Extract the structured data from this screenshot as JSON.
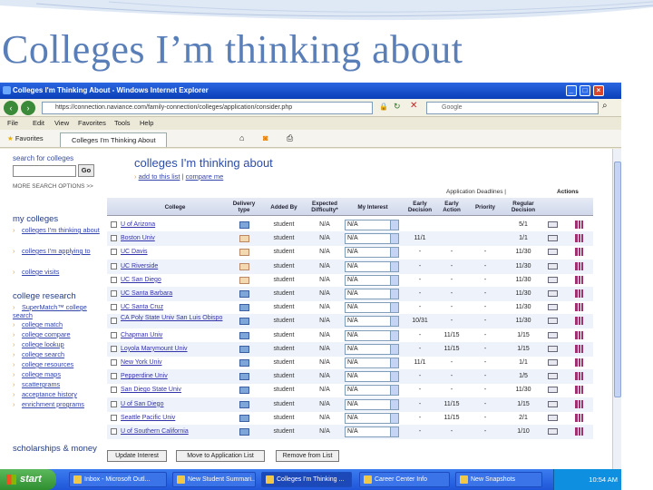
{
  "slide": {
    "title": "Colleges I’m thinking about"
  },
  "window": {
    "title": "Colleges I'm Thinking About - Windows Internet Explorer",
    "url": "https://connection.naviance.com/family-connection/colleges/application/consider.php",
    "search_placeholder": "Google",
    "menu": [
      "File",
      "Edit",
      "View",
      "Favorites",
      "Tools",
      "Help"
    ],
    "favorites_label": "Favorites",
    "tab_label": "Colleges I'm Thinking About"
  },
  "sidebar": {
    "search_label": "search for colleges",
    "go_label": "Go",
    "more_options": "MORE SEARCH OPTIONS >>",
    "my_colleges_heading": "my colleges",
    "my_colleges_links": [
      "colleges I'm thinking about",
      "colleges I'm applying to",
      "college visits"
    ],
    "research_heading": "college research",
    "research_links": [
      "SuperMatch™ college search",
      "college match",
      "college compare",
      "college lookup",
      "college search",
      "college resources",
      "college maps",
      "scattergrams",
      "acceptance history",
      "enrichment programs"
    ],
    "scholarships_heading": "scholarships & money"
  },
  "main": {
    "title": "colleges I'm thinking about",
    "add_link": "add to this list",
    "sep": "|",
    "compare_link": "compare me"
  },
  "table": {
    "deadlines_header": "Application Deadlines |",
    "actions_header": "Actions",
    "columns": {
      "college": "College",
      "delivery": "Delivery type",
      "added_by": "Added By",
      "difficulty": "Expected Difficulty*",
      "interest": "My Interest",
      "early_decision": "Early Decision",
      "early_action": "Early Action",
      "priority": "Priority",
      "regular": "Regular Decision"
    },
    "rows": [
      {
        "college": "U of Arizona",
        "delivery": "mon",
        "added_by": "student",
        "difficulty": "N/A",
        "interest": "N/A",
        "ed": "",
        "ea": "",
        "pr": "",
        "rd": "5/1"
      },
      {
        "college": "Boston Univ",
        "delivery": "mail",
        "added_by": "student",
        "difficulty": "N/A",
        "interest": "N/A",
        "ed": "11/1",
        "ea": "",
        "pr": "",
        "rd": "1/1"
      },
      {
        "college": "UC Davis",
        "delivery": "mail",
        "added_by": "student",
        "difficulty": "N/A",
        "interest": "N/A",
        "ed": "-",
        "ea": "-",
        "pr": "-",
        "rd": "11/30"
      },
      {
        "college": "UC Riverside",
        "delivery": "mail",
        "added_by": "student",
        "difficulty": "N/A",
        "interest": "N/A",
        "ed": "-",
        "ea": "-",
        "pr": "-",
        "rd": "11/30"
      },
      {
        "college": "UC San Diego",
        "delivery": "mail",
        "added_by": "student",
        "difficulty": "N/A",
        "interest": "N/A",
        "ed": "-",
        "ea": "-",
        "pr": "-",
        "rd": "11/30"
      },
      {
        "college": "UC Santa Barbara",
        "delivery": "mon",
        "added_by": "student",
        "difficulty": "N/A",
        "interest": "N/A",
        "ed": "-",
        "ea": "-",
        "pr": "-",
        "rd": "11/30"
      },
      {
        "college": "UC Santa Cruz",
        "delivery": "mon",
        "added_by": "student",
        "difficulty": "N/A",
        "interest": "N/A",
        "ed": "-",
        "ea": "-",
        "pr": "-",
        "rd": "11/30"
      },
      {
        "college": "CA Poly State Univ San Luis Obispo",
        "delivery": "mon",
        "added_by": "student",
        "difficulty": "N/A",
        "interest": "N/A",
        "ed": "10/31",
        "ea": "-",
        "pr": "-",
        "rd": "11/30"
      },
      {
        "college": "Chapman Univ",
        "delivery": "mon",
        "added_by": "student",
        "difficulty": "N/A",
        "interest": "N/A",
        "ed": "-",
        "ea": "11/15",
        "pr": "-",
        "rd": "1/15"
      },
      {
        "college": "Loyola Marymount Univ",
        "delivery": "mon",
        "added_by": "student",
        "difficulty": "N/A",
        "interest": "N/A",
        "ed": "-",
        "ea": "11/15",
        "pr": "-",
        "rd": "1/15"
      },
      {
        "college": "New York Univ",
        "delivery": "mon",
        "added_by": "student",
        "difficulty": "N/A",
        "interest": "N/A",
        "ed": "11/1",
        "ea": "-",
        "pr": "-",
        "rd": "1/1"
      },
      {
        "college": "Pepperdine Univ",
        "delivery": "mon",
        "added_by": "student",
        "difficulty": "N/A",
        "interest": "N/A",
        "ed": "-",
        "ea": "-",
        "pr": "-",
        "rd": "1/5"
      },
      {
        "college": "San Diego State Univ",
        "delivery": "mon",
        "added_by": "student",
        "difficulty": "N/A",
        "interest": "N/A",
        "ed": "-",
        "ea": "-",
        "pr": "-",
        "rd": "11/30"
      },
      {
        "college": "U of San Diego",
        "delivery": "mon",
        "added_by": "student",
        "difficulty": "N/A",
        "interest": "N/A",
        "ed": "-",
        "ea": "11/15",
        "pr": "-",
        "rd": "1/15"
      },
      {
        "college": "Seattle Pacific Univ",
        "delivery": "mon",
        "added_by": "student",
        "difficulty": "N/A",
        "interest": "N/A",
        "ed": "-",
        "ea": "11/15",
        "pr": "-",
        "rd": "2/1"
      },
      {
        "college": "U of Southern California",
        "delivery": "mon",
        "added_by": "student",
        "difficulty": "N/A",
        "interest": "N/A",
        "ed": "-",
        "ea": "-",
        "pr": "-",
        "rd": "1/10"
      }
    ]
  },
  "buttons": {
    "update": "Update Interest",
    "move": "Move to Application List",
    "remove": "Remove from List"
  },
  "taskbar": {
    "start": "start",
    "items": [
      "Inbox - Microsoft Outl...",
      "New Student Summari...",
      "Colleges I'm Thinking ...",
      "Career Center Info",
      "New Snapshots"
    ],
    "clock": "10:54 AM"
  }
}
